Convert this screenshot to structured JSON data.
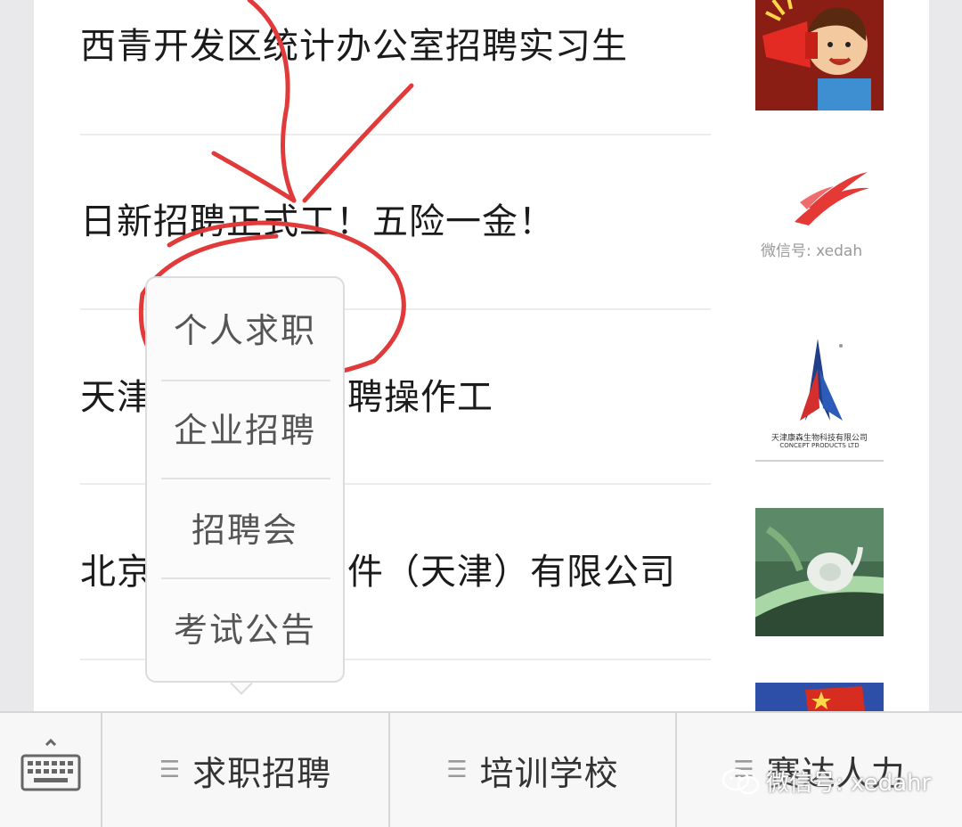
{
  "feed": {
    "articles": [
      {
        "title": "西青开发区统计办公室招聘实习生",
        "thumb_icon": "megaphone-cartoon-icon"
      },
      {
        "title": "日新招聘正式工！五险一金！",
        "thumb_icon": "red-swoosh-logo-icon",
        "thumb_watermark": "微信号: xedah"
      },
      {
        "title": "天津康森生物科技有限公司招聘操作工",
        "title_visible_left": "天津",
        "title_visible_right": "聘操作工",
        "thumb_icon": "company-logo-icon",
        "thumb_caption": "天津康森生物科技有限公司",
        "thumb_caption_en": "CONCEPT PRODUCTS LTD"
      },
      {
        "title": "北京……件（天津）有限公司",
        "title_visible_left": "北京",
        "title_visible_right": "件（天津）有限公司",
        "thumb_icon": "snail-photo-icon"
      },
      {
        "title": "",
        "thumb_icon": "flag-photo-icon"
      }
    ]
  },
  "popup_menu": {
    "items": [
      {
        "label": "个人求职",
        "highlighted": true
      },
      {
        "label": "企业招聘"
      },
      {
        "label": "招聘会"
      },
      {
        "label": "考试公告"
      }
    ]
  },
  "bottom_menu": {
    "keyboard_icon": "keyboard-icon",
    "items": [
      {
        "label": "求职招聘",
        "icon": "hamburger-icon"
      },
      {
        "label": "培训学校",
        "icon": "hamburger-icon"
      },
      {
        "label": "赛达人力",
        "icon": "hamburger-icon"
      }
    ]
  },
  "watermark": {
    "text": "微信号: xedahr"
  },
  "colors": {
    "annotation": "#e03a3a",
    "background": "#e9e9ec",
    "menubar": "#f7f7f8"
  }
}
